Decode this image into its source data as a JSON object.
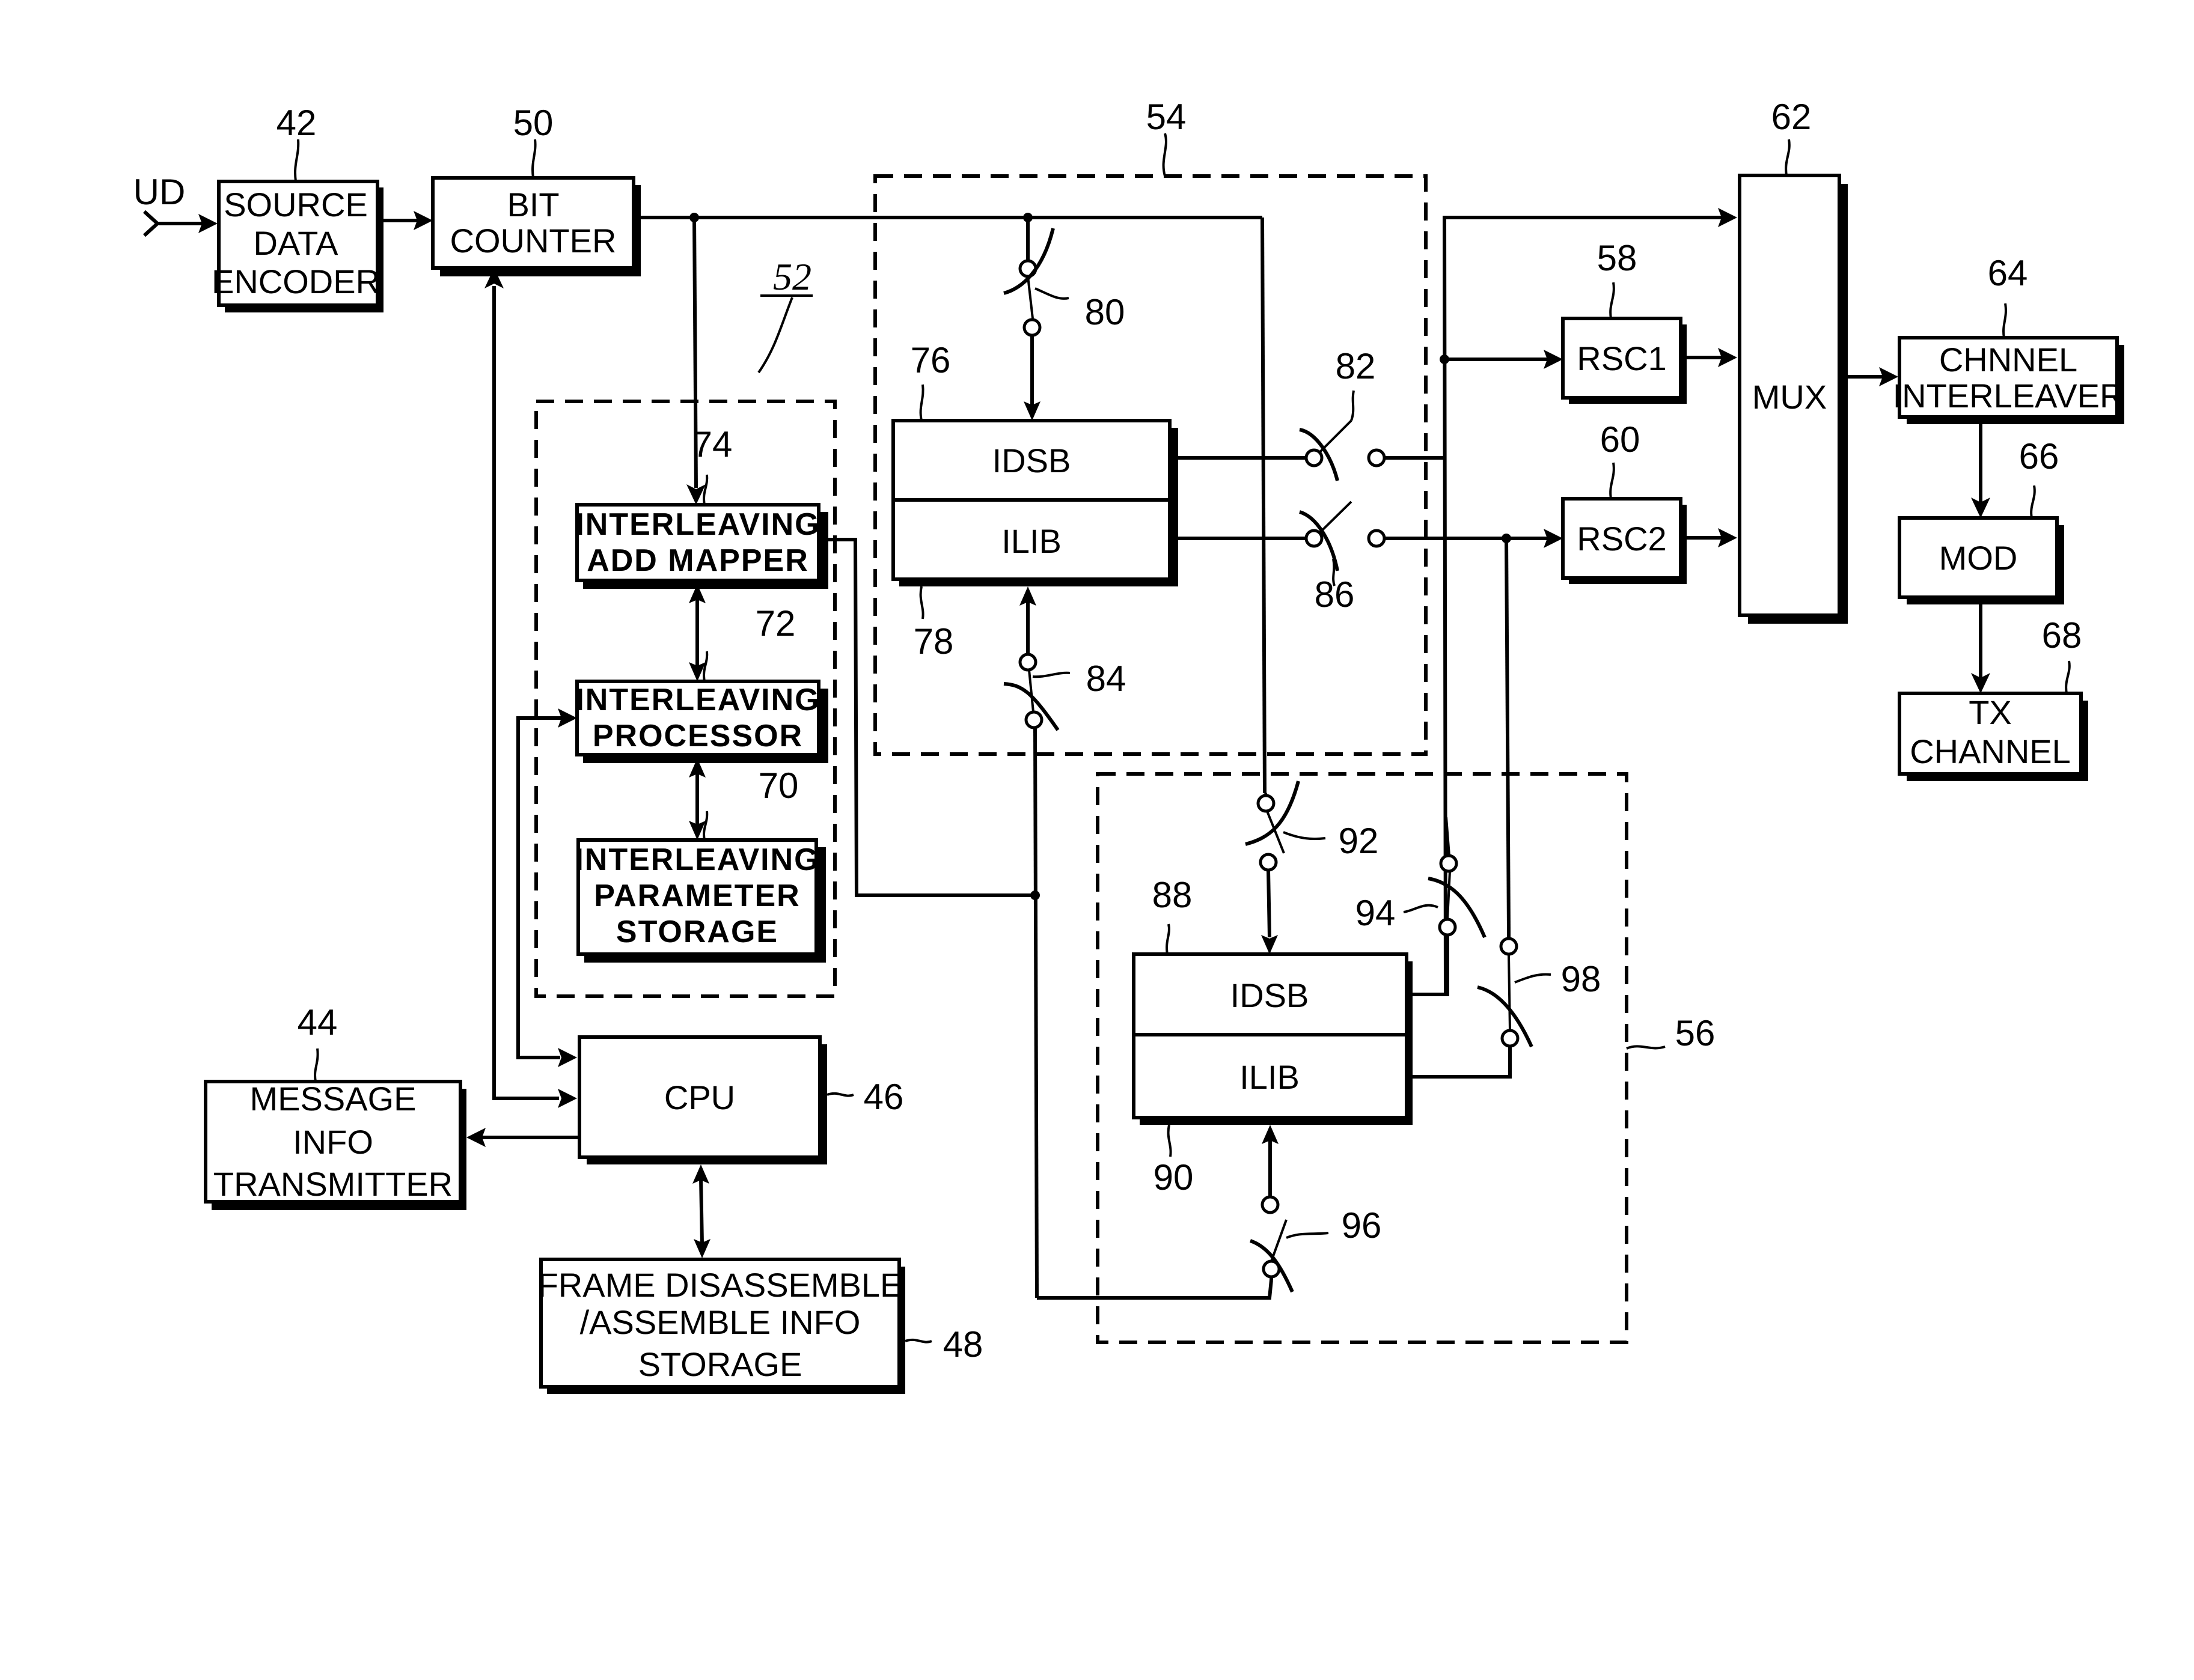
{
  "figure": {
    "input_label": "UD",
    "blocks": {
      "source_data_encoder": {
        "ref": "42",
        "lines": [
          "SOURCE",
          "DATA",
          "ENCODER"
        ]
      },
      "bit_counter": {
        "ref": "50",
        "lines": [
          "BIT",
          "COUNTER"
        ]
      },
      "interleaver_group": {
        "ref": "52"
      },
      "interleaving_add_mapper": {
        "ref": "74",
        "lines": [
          "INTERLEAVING",
          "ADD  MAPPER"
        ]
      },
      "interleaving_processor": {
        "ref": "72",
        "lines": [
          "INTERLEAVING",
          "PROCESSOR"
        ]
      },
      "interleaving_parameter_storage": {
        "ref": "70",
        "lines": [
          "INTERLEAVING",
          "PARAMETER",
          "STORAGE"
        ]
      },
      "buffer_unit_1": {
        "ref": "54"
      },
      "idsb_1": {
        "ref": "76",
        "label": "IDSB"
      },
      "ilib_1": {
        "ref": "78",
        "label": "ILIB"
      },
      "buffer_unit_2": {
        "ref": "56"
      },
      "idsb_2": {
        "ref": "88",
        "label": "IDSB"
      },
      "ilib_2": {
        "ref": "90",
        "label": "ILIB"
      },
      "rsc1": {
        "ref": "58",
        "label": "RSC1"
      },
      "rsc2": {
        "ref": "60",
        "label": "RSC2"
      },
      "mux": {
        "ref": "62",
        "label": "MUX"
      },
      "channel_interleaver": {
        "ref": "64",
        "lines": [
          "CHNNEL",
          "INTERLEAVER"
        ]
      },
      "mod": {
        "ref": "66",
        "label": "MOD"
      },
      "tx_channel": {
        "ref": "68",
        "lines": [
          "TX",
          "CHANNEL"
        ]
      },
      "message_info_transmitter": {
        "ref": "44",
        "lines": [
          "MESSAGE",
          "INFO",
          "TRANSMITTER"
        ]
      },
      "cpu": {
        "ref": "46",
        "label": "CPU"
      },
      "frame_info_storage": {
        "ref": "48",
        "lines": [
          "FRAME DISASSEMBLE",
          "/ASSEMBLE INFO",
          "STORAGE"
        ]
      }
    },
    "switches": {
      "sw80": "80",
      "sw82": "82",
      "sw84": "84",
      "sw86": "86",
      "sw92": "92",
      "sw94": "94",
      "sw96": "96",
      "sw98": "98"
    }
  }
}
